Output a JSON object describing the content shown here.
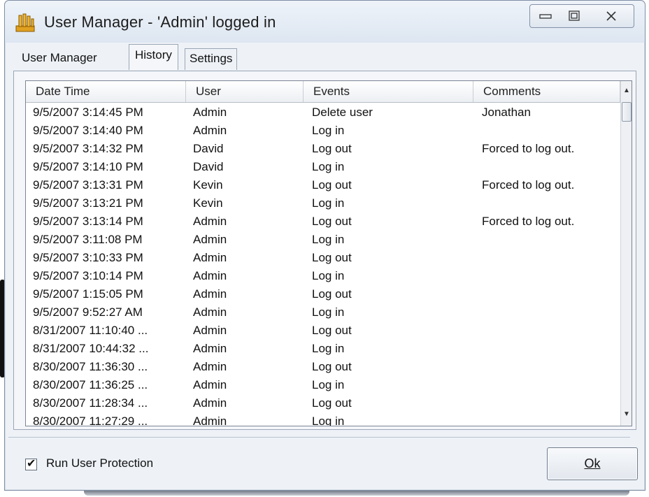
{
  "window": {
    "title": "User Manager - 'Admin' logged in",
    "icon": "users-app-icon"
  },
  "window_controls": {
    "minimize_icon": "minimize-icon",
    "maximize_icon": "maximize-icon",
    "close_icon": "close-icon"
  },
  "tabs": [
    {
      "label": "User Manager",
      "active": false
    },
    {
      "label": "History",
      "active": true
    },
    {
      "label": "Settings",
      "active": false
    }
  ],
  "history": {
    "columns": [
      "Date Time",
      "User",
      "Events",
      "Comments"
    ],
    "rows": [
      [
        "9/5/2007 3:14:45 PM",
        "Admin",
        "Delete user",
        "Jonathan"
      ],
      [
        "9/5/2007 3:14:40 PM",
        "Admin",
        "Log in",
        ""
      ],
      [
        "9/5/2007 3:14:32 PM",
        "David",
        "Log out",
        "Forced to log out."
      ],
      [
        "9/5/2007 3:14:10 PM",
        "David",
        "Log in",
        ""
      ],
      [
        "9/5/2007 3:13:31 PM",
        "Kevin",
        "Log out",
        "Forced to log out."
      ],
      [
        "9/5/2007 3:13:21 PM",
        "Kevin",
        "Log in",
        ""
      ],
      [
        "9/5/2007 3:13:14 PM",
        "Admin",
        "Log out",
        "Forced to log out."
      ],
      [
        "9/5/2007 3:11:08 PM",
        "Admin",
        "Log in",
        ""
      ],
      [
        "9/5/2007 3:10:33 PM",
        "Admin",
        "Log out",
        ""
      ],
      [
        "9/5/2007 3:10:14 PM",
        "Admin",
        "Log in",
        ""
      ],
      [
        "9/5/2007 1:15:05 PM",
        "Admin",
        "Log out",
        ""
      ],
      [
        "9/5/2007 9:52:27 AM",
        "Admin",
        "Log in",
        ""
      ],
      [
        "8/31/2007 11:10:40 ...",
        "Admin",
        "Log out",
        ""
      ],
      [
        "8/31/2007 10:44:32 ...",
        "Admin",
        "Log in",
        ""
      ],
      [
        "8/30/2007 11:36:30 ...",
        "Admin",
        "Log out",
        ""
      ],
      [
        "8/30/2007 11:36:25 ...",
        "Admin",
        "Log in",
        ""
      ],
      [
        "8/30/2007 11:28:34 ...",
        "Admin",
        "Log out",
        ""
      ],
      [
        "8/30/2007 11:27:29 ...",
        "Admin",
        "Log in",
        ""
      ]
    ]
  },
  "options": {
    "run_user_protection_label": "Run User Protection",
    "run_user_protection_checked": true,
    "check_mark": "✔"
  },
  "buttons": {
    "ok_label": "Ok"
  }
}
